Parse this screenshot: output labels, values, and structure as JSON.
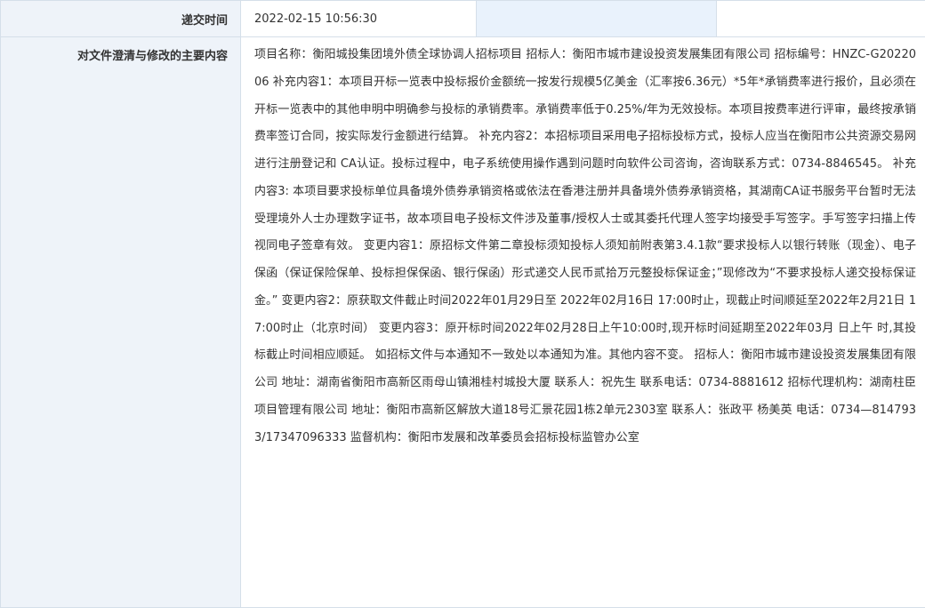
{
  "rows": {
    "submit_time": {
      "label": "递交时间",
      "value": "2022-02-15 10:56:30"
    },
    "content": {
      "label": "对文件澄清与修改的主要内容",
      "text": "项目名称：衡阳城投集团境外债全球协调人招标项目 招标人：衡阳市城市建设投资发展集团有限公司 招标编号：HNZC-G2022006 补充内容1：本项目开标一览表中投标报价金额统一按发行规模5亿美金（汇率按6.36元）*5年*承销费率进行报价，且必须在开标一览表中的其他申明中明确参与投标的承销费率。承销费率低于0.25%/年为无效投标。本项目按费率进行评审，最终按承销费率签订合同，按实际发行金额进行结算。 补充内容2：本招标项目采用电子招标投标方式，投标人应当在衡阳市公共资源交易网进行注册登记和 CA认证。投标过程中，电子系统使用操作遇到问题时向软件公司咨询，咨询联系方式：0734-8846545。 补充内容3: 本项目要求投标单位具备境外债券承销资格或依法在香港注册并具备境外债券承销资格，其湖南CA证书服务平台暂时无法受理境外人士办理数字证书，故本项目电子投标文件涉及董事/授权人士或其委托代理人签字均接受手写签字。手写签字扫描上传视同电子签章有效。 变更内容1：原招标文件第二章投标须知投标人须知前附表第3.4.1款“要求投标人以银行转账（现金）、电子保函（保证保险保单、投标担保保函、银行保函）形式递交人民币贰拾万元整投标保证金；”现修改为“不要求投标人递交投标保证金。” 变更内容2：原获取文件截止时间2022年01月29日至 2022年02月16日 17:00时止，现截止时间顺延至2022年2月21日 17:00时止（北京时间） 变更内容3：原开标时间2022年02月28日上午10:00时,现开标时间延期至2022年03月 日上午 时,其投标截止时间相应顺延。 如招标文件与本通知不一致处以本通知为准。其他内容不变。 招标人：衡阳市城市建设投资发展集团有限公司 地址：湖南省衡阳市高新区雨母山镇湘桂村城投大厦 联系人：祝先生 联系电话：0734-8881612 招标代理机构：湖南柱臣项目管理有限公司 地址：衡阳市高新区解放大道18号汇景花园1栋2单元2303室 联系人：张政平 杨美英 电话：0734—8147933/17347096333 监督机构：衡阳市发展和改革委员会招标投标监管办公室"
    }
  }
}
